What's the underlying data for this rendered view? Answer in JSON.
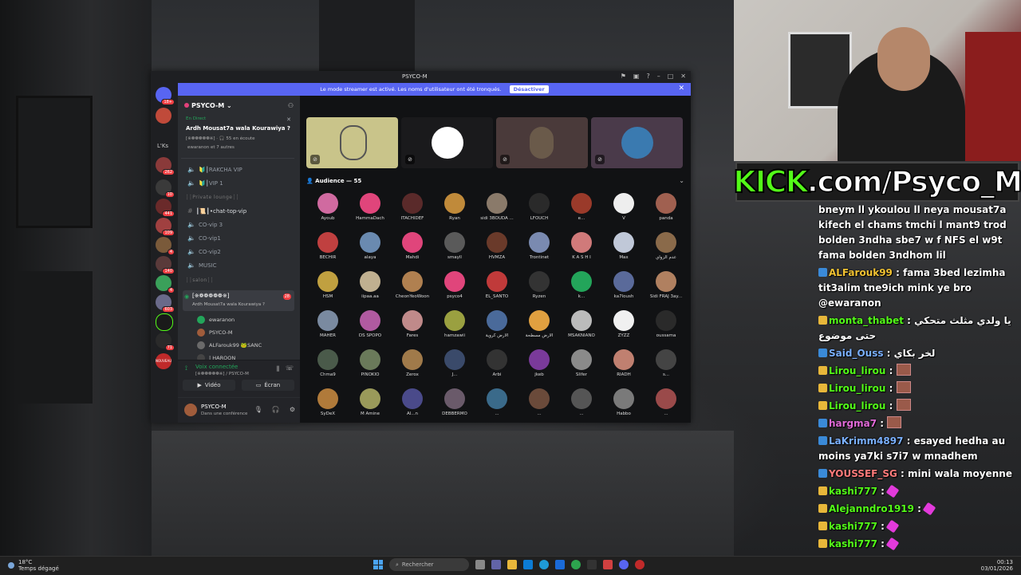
{
  "discord": {
    "window_title": "PSYCO-M",
    "streamer_banner": {
      "text": "Le mode streamer est activé. Les noms d'utilisateur ont été tronqués.",
      "button": "Désactiver"
    },
    "rail": {
      "lks_label": "L'Ks",
      "badges": [
        "18+",
        "262",
        "10",
        "441",
        "109",
        "4",
        "140",
        "4",
        "603",
        "71"
      ],
      "nouveau": "NOUVEAU"
    },
    "server_name": "PSYCO-M",
    "event": {
      "live": "En Direct",
      "name": "Ardh Mousat7a wala Kourawiya ?",
      "listeners": "[※❁❁❁❁❁※] · 🎧 55 en écoute",
      "speakers": "ewaranon et 7 autres"
    },
    "channels": [
      {
        "label": "🔰┃RAKCHA VIP"
      },
      {
        "label": "🔰┃VIP 1"
      }
    ],
    "category_private": "┊┊Private lounge┊┊",
    "text_channel": "┃📜┃•chat-top-vip",
    "voice_channels": [
      "CO-vip 3",
      "CO-vip1",
      "CO-vip2",
      "MUSIC"
    ],
    "category_salon": "┊┊salon┊┊",
    "active_voice": {
      "label": "[※❁❁❁❁❁※]",
      "sub": "Ardh Mousat7a wala Kourawiya ?",
      "badge": "28"
    },
    "members": [
      "ewaranon",
      "PSYCO-M",
      "ALFarouk99 🐸SANC",
      "| HAROON"
    ],
    "voice_panel": {
      "status": "Voix connectée",
      "channel": "[※❁❁❁❁❁※] / PSYCO-M",
      "video": "Vidéo",
      "screen": "Écran"
    },
    "user": {
      "name": "PSYCO-M",
      "status": "Dans une conférence"
    },
    "audience_header": "Audience — 55",
    "audience": [
      {
        "name": "Ayoub",
        "color": "#d06aa0"
      },
      {
        "name": "HammaDach",
        "color": "#e0457b"
      },
      {
        "name": "ITACHIDEF",
        "color": "#5a2a2a"
      },
      {
        "name": "Ryan",
        "color": "#c08a3a"
      },
      {
        "name": "sidi 3BOUDA ...",
        "color": "#8a7a6a"
      },
      {
        "name": "LFOUCH",
        "color": "#2a2a2a"
      },
      {
        "name": "e...",
        "color": "#9a3a2a"
      },
      {
        "name": "V",
        "color": "#eeeeee"
      },
      {
        "name": "panda",
        "color": "#a06050"
      },
      {
        "name": "BECHIR",
        "color": "#c04040"
      },
      {
        "name": "alaya",
        "color": "#6a8ab0"
      },
      {
        "name": "Mahdi",
        "color": "#e0457b"
      },
      {
        "name": "smayll",
        "color": "#5a5a5a"
      },
      {
        "name": "HVMZA",
        "color": "#6a3a2a"
      },
      {
        "name": "Trontinet",
        "color": "#7a8ab0"
      },
      {
        "name": "K A S H I",
        "color": "#d07a7a"
      },
      {
        "name": "Max",
        "color": "#c0c8d8"
      },
      {
        "name": "عدم الزواي",
        "color": "#8a6a4a"
      },
      {
        "name": "HSM",
        "color": "#c0a040"
      },
      {
        "name": "iipaa.aa",
        "color": "#c0b090"
      },
      {
        "name": "CheonYeoWoon",
        "color": "#b08050"
      },
      {
        "name": "psyco4",
        "color": "#e0457b"
      },
      {
        "name": "EL_SANTO",
        "color": "#c03a3a"
      },
      {
        "name": "Ryzen",
        "color": "#333333"
      },
      {
        "name": "k...",
        "color": "#23a55a"
      },
      {
        "name": "ka7loush",
        "color": "#5a6a9a"
      },
      {
        "name": "Sidi FRAJ 3ay...",
        "color": "#b08060"
      },
      {
        "name": "MAHER",
        "color": "#7a8aa0"
      },
      {
        "name": "DS SPOPO",
        "color": "#b05aa0"
      },
      {
        "name": "Fares",
        "color": "#c08a8a"
      },
      {
        "name": "hamzawii",
        "color": "#9aa040"
      },
      {
        "name": "الأرض كروية",
        "color": "#4a6a9a"
      },
      {
        "name": "الأرض مسطحة",
        "color": "#e0a040"
      },
      {
        "name": "MSAKNIANO",
        "color": "#bbbbbb"
      },
      {
        "name": "ZYZZ",
        "color": "#f0f0f0"
      },
      {
        "name": "oussama",
        "color": "#2a2a2a"
      },
      {
        "name": "Chma9",
        "color": "#4a5a4a"
      },
      {
        "name": "PINOKIO",
        "color": "#6a7a5a"
      },
      {
        "name": "Zerox",
        "color": "#a07a4a"
      },
      {
        "name": "J...",
        "color": "#3a4a6a"
      },
      {
        "name": "Arbi",
        "color": "#333333"
      },
      {
        "name": "jkeb",
        "color": "#7a3a9a"
      },
      {
        "name": "Slifer",
        "color": "#8a8a8a"
      },
      {
        "name": "RIADH",
        "color": "#c08070"
      },
      {
        "name": "s...",
        "color": "#444444"
      },
      {
        "name": "SyDeX",
        "color": "#b07a3a"
      },
      {
        "name": "M Amine",
        "color": "#9a9a5a"
      },
      {
        "name": "Al...n",
        "color": "#4a4a8a"
      },
      {
        "name": "DEBBERMO",
        "color": "#6a5a6a"
      },
      {
        "name": "...",
        "color": "#3a6a8a"
      },
      {
        "name": "...",
        "color": "#6a4a3a"
      },
      {
        "name": "...",
        "color": "#555555"
      },
      {
        "name": "Habbo",
        "color": "#7a7a7a"
      },
      {
        "name": "...",
        "color": "#9a4a4a"
      },
      {
        "name": "IDEXIMOUA",
        "color": "#7aa03a"
      }
    ],
    "speakers": [
      {
        "color": "#c9c48a"
      },
      {
        "color": "#1a1a1c"
      },
      {
        "color": "#4a3a3a"
      },
      {
        "color": "#4a3a4a"
      }
    ]
  },
  "kick": {
    "prefix": "KICK",
    "suffix": ".com/Psyco_M"
  },
  "chat": [
    {
      "user": "",
      "text": "bneym ll ykoulou ll neya mousat7a kifech el chams tmchi l mant9 trod bolden 3ndha sbe7 w f NFS el w9t fama bolden 3ndhom lil",
      "color": "#ffffff"
    },
    {
      "user": "ALFarouk99",
      "text": "fama 3bed lezimha tit3alim tne9ich mink ye bro @ewaranon",
      "color": "#f1c232"
    },
    {
      "user": "monta_thabet",
      "text": "يا ولدي مثلث متحكي حتى موضوع",
      "color": "#53fc18"
    },
    {
      "user": "Said_Ouss",
      "text": "لخر بكاي",
      "color": "#7ab0ff"
    },
    {
      "user": "Lirou_lirou",
      "text": "",
      "color": "#53fc18"
    },
    {
      "user": "Lirou_lirou",
      "text": "",
      "color": "#53fc18"
    },
    {
      "user": "Lirou_lirou",
      "text": "",
      "color": "#53fc18"
    },
    {
      "user": "hargma7",
      "text": "",
      "color": "#e06ad8"
    },
    {
      "user": "LaKrimm4897",
      "text": "esayed hedha au moins ya7ki s7i7 w mnadhem",
      "color": "#7ab0ff"
    },
    {
      "user": "YOUSSEF_SG",
      "text": "mini wala moyenne",
      "color": "#ff7a7a"
    },
    {
      "user": "kashi777",
      "text": "",
      "color": "#53fc18"
    },
    {
      "user": "Alejanndro1919",
      "text": "",
      "color": "#53fc18"
    },
    {
      "user": "kashi777",
      "text": "",
      "color": "#53fc18"
    },
    {
      "user": "kashi777",
      "text": "",
      "color": "#53fc18"
    },
    {
      "user": "kashi777",
      "text": "",
      "color": "#53fc18"
    }
  ],
  "taskbar": {
    "temp": "18°C",
    "weather": "Temps dégagé",
    "search": "Rechercher",
    "time": "00:13",
    "date": "03/01/2026"
  }
}
